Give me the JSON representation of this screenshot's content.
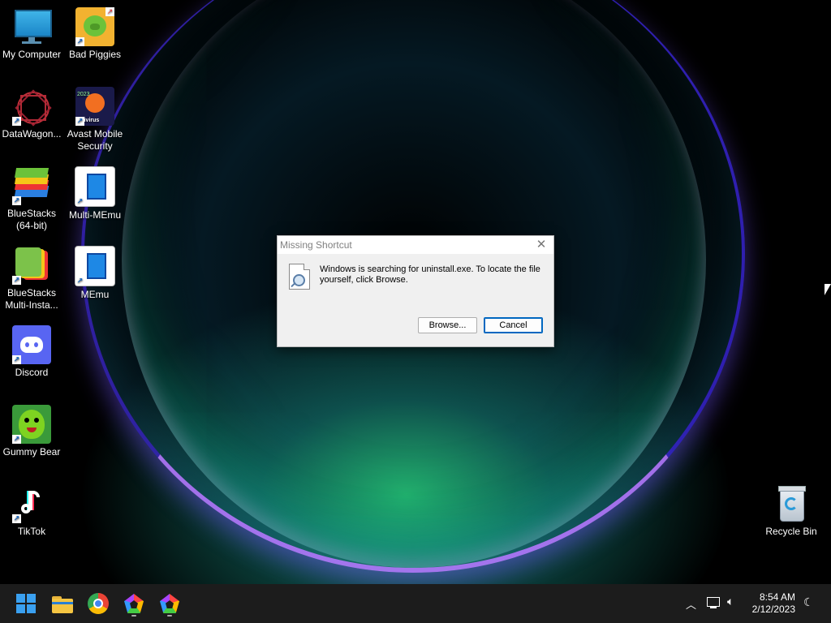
{
  "desktop": {
    "icons": [
      {
        "label": "My Computer",
        "icon": "monitor-icon"
      },
      {
        "label": "Bad Piggies",
        "icon": "green-pig-icon"
      },
      {
        "label": "DataWagon...",
        "icon": "red-star-icon"
      },
      {
        "label": "Avast Mobile Security",
        "icon": "avast-icon"
      },
      {
        "label": "BlueStacks (64-bit)",
        "icon": "bluestacks-icon"
      },
      {
        "label": "Multi-MEmu",
        "icon": "memu-icon"
      },
      {
        "label": "BlueStacks Multi-Insta...",
        "icon": "bluestacks-multi-icon"
      },
      {
        "label": "MEmu",
        "icon": "memu-icon"
      },
      {
        "label": "Discord",
        "icon": "discord-icon"
      },
      {
        "label": "Gummy Bear",
        "icon": "gummy-bear-icon"
      },
      {
        "label": "TikTok",
        "icon": "tiktok-icon"
      },
      {
        "label": "Recycle Bin",
        "icon": "recycle-bin-icon"
      }
    ],
    "avast_badge": "2023",
    "avast_text": "ntivirus"
  },
  "dialog": {
    "title": "Missing Shortcut",
    "message": "Windows is searching for uninstall.exe. To locate the file yourself, click Browse.",
    "browse_label": "Browse...",
    "cancel_label": "Cancel"
  },
  "taskbar": {
    "items": [
      "start-icon",
      "file-explorer-icon",
      "chrome-icon",
      "app-pentagon-icon",
      "app-pentagon-icon"
    ],
    "time": "8:54 AM",
    "date": "2/12/2023"
  },
  "colors": {
    "dialog_bg": "#f0f0f0",
    "accent": "#0067c0",
    "taskbar": "#1c1c1c",
    "discord": "#5865f2"
  }
}
